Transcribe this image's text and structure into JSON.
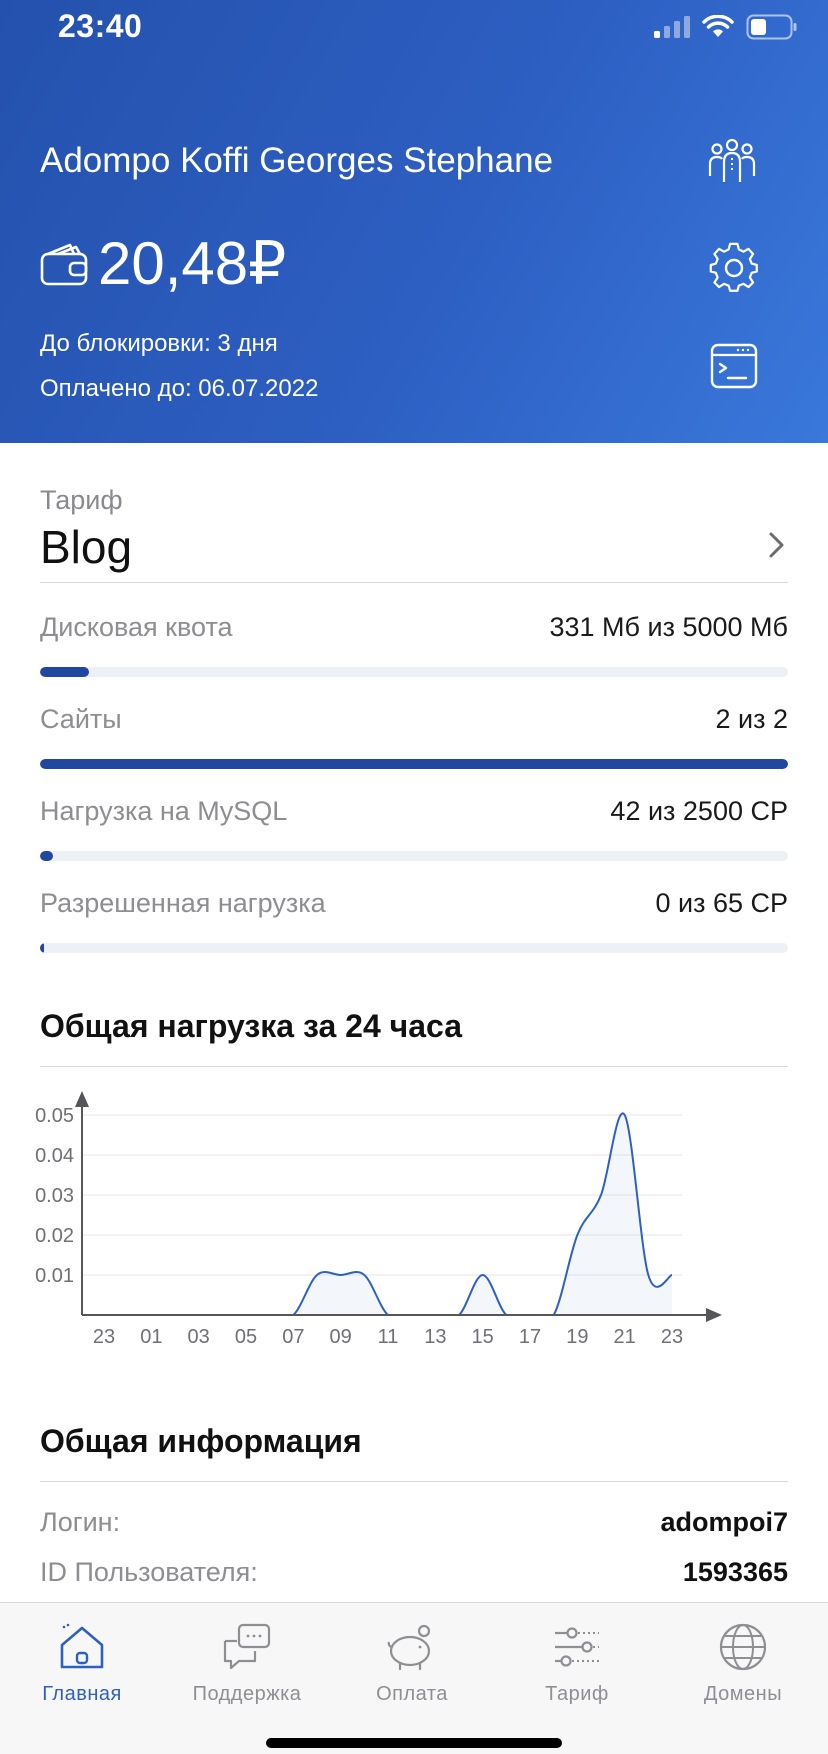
{
  "status_bar": {
    "time": "23:40"
  },
  "header": {
    "user_name": "Adompo Koffi Georges Stephane",
    "balance": "20,48₽",
    "block_info": "До блокировки: 3 дня",
    "paid_info": "Оплачено до: 06.07.2022"
  },
  "tariff": {
    "label": "Тариф",
    "name": "Blog"
  },
  "quotas": [
    {
      "label": "Дисковая квота",
      "value": "331 Мб из 5000 Мб",
      "fill_percent": 6.6
    },
    {
      "label": "Сайты",
      "value": "2 из 2",
      "fill_percent": 100
    },
    {
      "label": "Нагрузка на MySQL",
      "value": "42 из 2500 CP",
      "fill_percent": 1.7
    },
    {
      "label": "Разрешенная нагрузка",
      "value": "0 из 65 CP",
      "fill_percent": 0
    }
  ],
  "chart_section": {
    "title": "Общая нагрузка за 24 часа"
  },
  "chart_data": {
    "type": "area",
    "x": [
      "23",
      "00",
      "01",
      "02",
      "03",
      "04",
      "05",
      "06",
      "07",
      "08",
      "09",
      "10",
      "11",
      "12",
      "13",
      "14",
      "15",
      "16",
      "17",
      "18",
      "19",
      "20",
      "21",
      "22",
      "23"
    ],
    "x_tick_labels": [
      "23",
      "01",
      "03",
      "05",
      "07",
      "09",
      "11",
      "13",
      "15",
      "17",
      "19",
      "21",
      "23"
    ],
    "y_tick_labels": [
      "0.01",
      "0.02",
      "0.03",
      "0.04",
      "0.05"
    ],
    "values": [
      0,
      0,
      0,
      0,
      0,
      0,
      0,
      0,
      0,
      0.01,
      0.01,
      0.01,
      0,
      0,
      0,
      0,
      0.01,
      0,
      0,
      0,
      0.02,
      0.03,
      0.05,
      0.01,
      0.01
    ],
    "ylim": [
      0,
      0.05
    ],
    "grid": true,
    "color": "#2f5fc0"
  },
  "general_info": {
    "title": "Общая информация",
    "rows": [
      {
        "label": "Логин:",
        "value": "adompoi7"
      },
      {
        "label": "ID Пользователя:",
        "value": "1593365"
      }
    ]
  },
  "tabbar": {
    "items": [
      {
        "label": "Главная",
        "icon": "home-icon",
        "active": true
      },
      {
        "label": "Поддержка",
        "icon": "chat-icon",
        "active": false
      },
      {
        "label": "Оплата",
        "icon": "piggy-bank-icon",
        "active": false
      },
      {
        "label": "Тариф",
        "icon": "sliders-icon",
        "active": false
      },
      {
        "label": "Домены",
        "icon": "globe-icon",
        "active": false
      }
    ]
  },
  "colors": {
    "header_start": "#2451ad",
    "header_end": "#3a78db",
    "accent": "#2148a0",
    "tab_active": "#2f5fc0"
  }
}
